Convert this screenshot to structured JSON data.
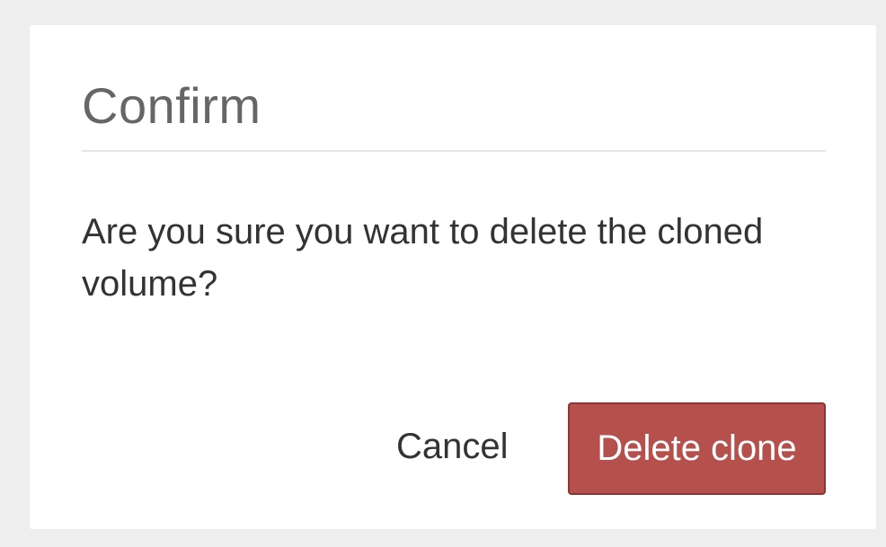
{
  "dialog": {
    "title": "Confirm",
    "message": "Are you sure you want to delete the cloned volume?",
    "cancel_label": "Cancel",
    "confirm_label": "Delete clone"
  },
  "colors": {
    "backdrop": "#eeeeee",
    "dialog_background": "#ffffff",
    "title_text": "#666666",
    "body_text": "#333333",
    "danger_button": "#b5504d",
    "danger_button_border": "#8f3434"
  }
}
